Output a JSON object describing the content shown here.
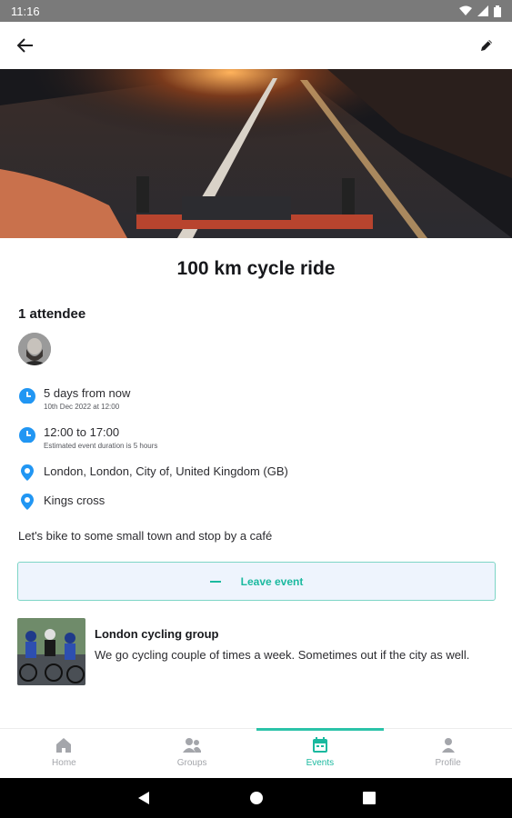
{
  "status_bar": {
    "time": "11:16"
  },
  "event": {
    "title": "100 km cycle ride",
    "attendees_label": "1 attendee",
    "when_relative": "5 days from now",
    "when_date": "10th Dec 2022 at 12:00",
    "time_range": "12:00 to 17:00",
    "duration_note": "Estimated event duration is 5 hours",
    "location": "London, London, City of, United Kingdom (GB)",
    "venue": "Kings cross",
    "description": "Let's bike to some small town and stop by a café",
    "leave_label": "Leave event"
  },
  "group": {
    "name": "London cycling group",
    "description": "We go cycling couple of times a week. Sometimes out if the city as well."
  },
  "bottom_nav": {
    "items": [
      {
        "label": "Home",
        "icon": "home-icon"
      },
      {
        "label": "Groups",
        "icon": "groups-icon"
      },
      {
        "label": "Events",
        "icon": "calendar-icon",
        "active": true
      },
      {
        "label": "Profile",
        "icon": "profile-icon"
      }
    ]
  },
  "colors": {
    "accent": "#1bb99f",
    "info_icon": "#2196f3",
    "leave_bg": "#eef4fd",
    "leave_border": "#7dd5c6"
  }
}
